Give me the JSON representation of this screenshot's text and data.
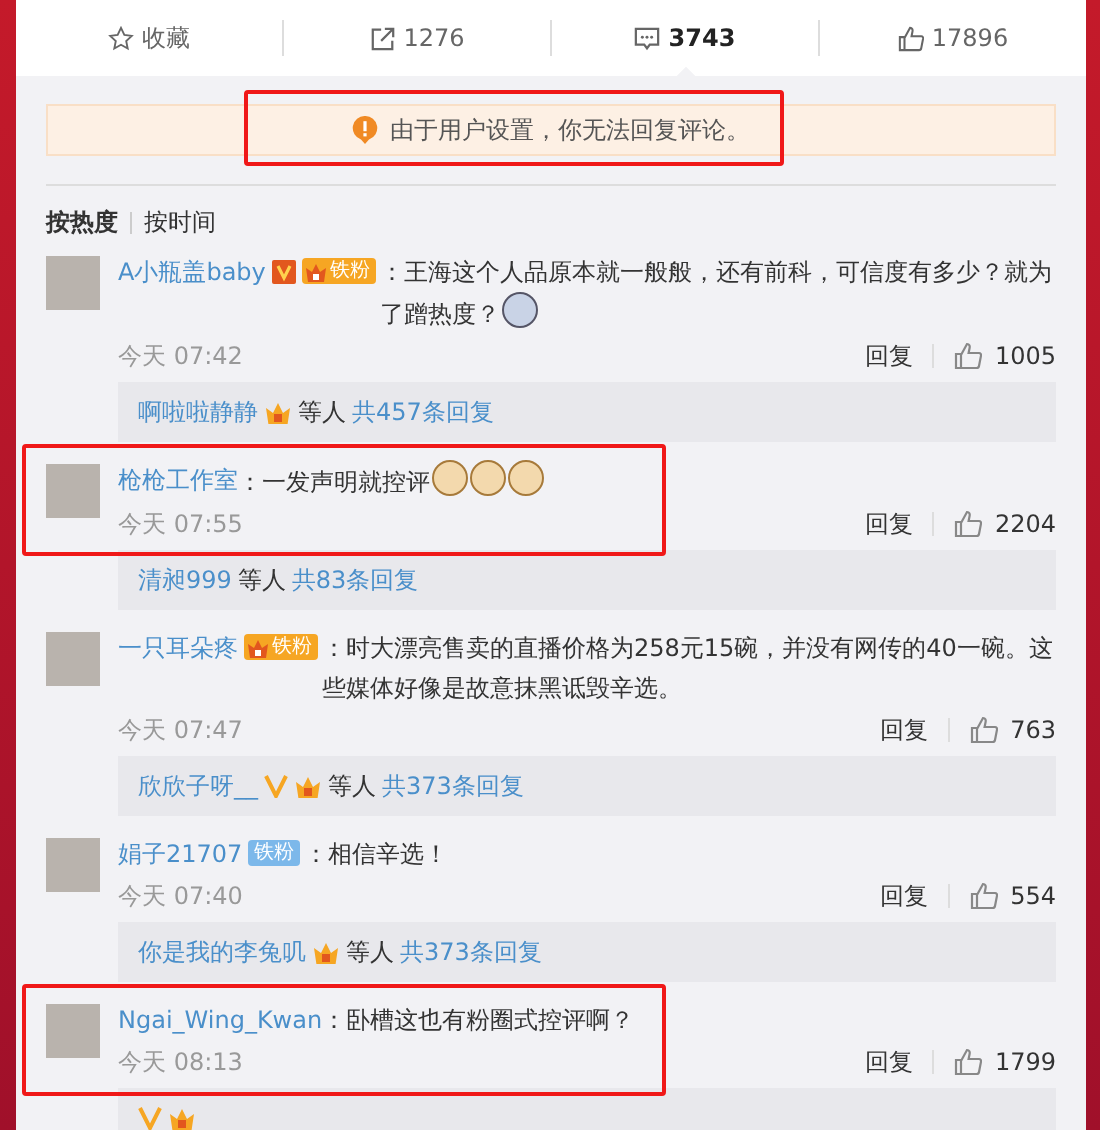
{
  "actions": [
    {
      "kind": "star",
      "label": "收藏",
      "selected": false
    },
    {
      "kind": "repost",
      "label": "1276",
      "selected": false
    },
    {
      "kind": "comment",
      "label": "3743",
      "selected": true
    },
    {
      "kind": "like",
      "label": "17896",
      "selected": false
    }
  ],
  "notice": {
    "text": "由于用户设置，你无法回复评论。",
    "highlighted": true
  },
  "sort_tabs": [
    {
      "label": "按热度",
      "selected": true
    },
    {
      "label": "按时间",
      "selected": false
    }
  ],
  "comments": [
    {
      "user": "A小瓶盖baby",
      "verified": true,
      "fan_badge": {
        "label": "铁粉",
        "kind": "gold"
      },
      "text": "：王海这个人品原本就一般般，还有前科，可信度有多少？就为了蹭热度？",
      "emojis": [
        {
          "kind": "face"
        }
      ],
      "time": "今天 07:42",
      "reply_label": "回复",
      "likes": "1005",
      "replies": {
        "user": "啊啦啦静静",
        "crown": true,
        "others": "等人",
        "count": "共457条回复"
      }
    },
    {
      "user": "枪枪工作室",
      "text": "：一发声明就控评",
      "emojis": [
        {
          "kind": "cat"
        },
        {
          "kind": "cat"
        },
        {
          "kind": "cat"
        }
      ],
      "time": "今天 07:55",
      "reply_label": "回复",
      "likes": "2204",
      "highlighted": true,
      "replies": {
        "user": "清昶999",
        "others": "等人",
        "count": "共83条回复"
      }
    },
    {
      "user": "一只耳朵疼",
      "fan_badge": {
        "label": "铁粉",
        "kind": "gold"
      },
      "text": "：时大漂亮售卖的直播价格为258元15碗，并没有网传的40一碗。这些媒体好像是故意抹黑诋毁辛选。",
      "time": "今天 07:47",
      "reply_label": "回复",
      "likes": "763",
      "replies": {
        "user": "欣欣子呀__",
        "verified": true,
        "crown": true,
        "others": "等人",
        "count": "共373条回复"
      }
    },
    {
      "user": "娟子21707",
      "fan_badge": {
        "label": "铁粉",
        "kind": "blue"
      },
      "text": "：相信辛选！",
      "time": "今天 07:40",
      "reply_label": "回复",
      "likes": "554",
      "replies": {
        "user": "你是我的李兔叽",
        "crown": true,
        "others": "等人",
        "count": "共373条回复"
      }
    },
    {
      "user": "Ngai_Wing_Kwan",
      "text": "：卧槽这也有粉圈式控评啊？",
      "time": "今天 08:13",
      "reply_label": "回复",
      "likes": "1799",
      "highlighted": true,
      "replies": {
        "verified": true,
        "crown": true
      }
    }
  ]
}
